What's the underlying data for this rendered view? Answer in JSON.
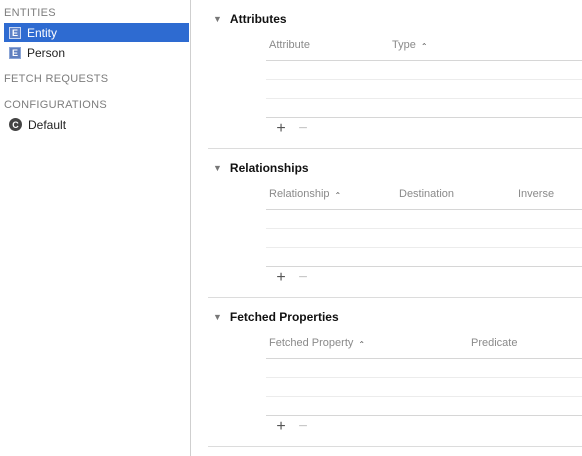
{
  "sidebar": {
    "entities_title": "ENTITIES",
    "entities": [
      {
        "badge": "E",
        "label": "Entity",
        "selected": true
      },
      {
        "badge": "E",
        "label": "Person",
        "selected": false
      }
    ],
    "fetch_requests_title": "FETCH REQUESTS",
    "configurations_title": "CONFIGURATIONS",
    "configurations": [
      {
        "badge": "C",
        "label": "Default"
      }
    ]
  },
  "attributes": {
    "title": "Attributes",
    "columns": [
      "Attribute",
      "Type"
    ],
    "sorted_column": "Type",
    "add": "+",
    "remove": "−"
  },
  "relationships": {
    "title": "Relationships",
    "columns": [
      "Relationship",
      "Destination",
      "Inverse"
    ],
    "sorted_column": "Relationship",
    "add": "+",
    "remove": "−"
  },
  "fetched_properties": {
    "title": "Fetched Properties",
    "columns": [
      "Fetched Property",
      "Predicate"
    ],
    "sorted_column": "Fetched Property",
    "add": "+",
    "remove": "−"
  },
  "icons": {
    "disclosure": "▼",
    "sort_chevron": "⌃"
  },
  "colors": {
    "selection": "#2e6bd1",
    "entity_badge": "#5f7fbf"
  }
}
